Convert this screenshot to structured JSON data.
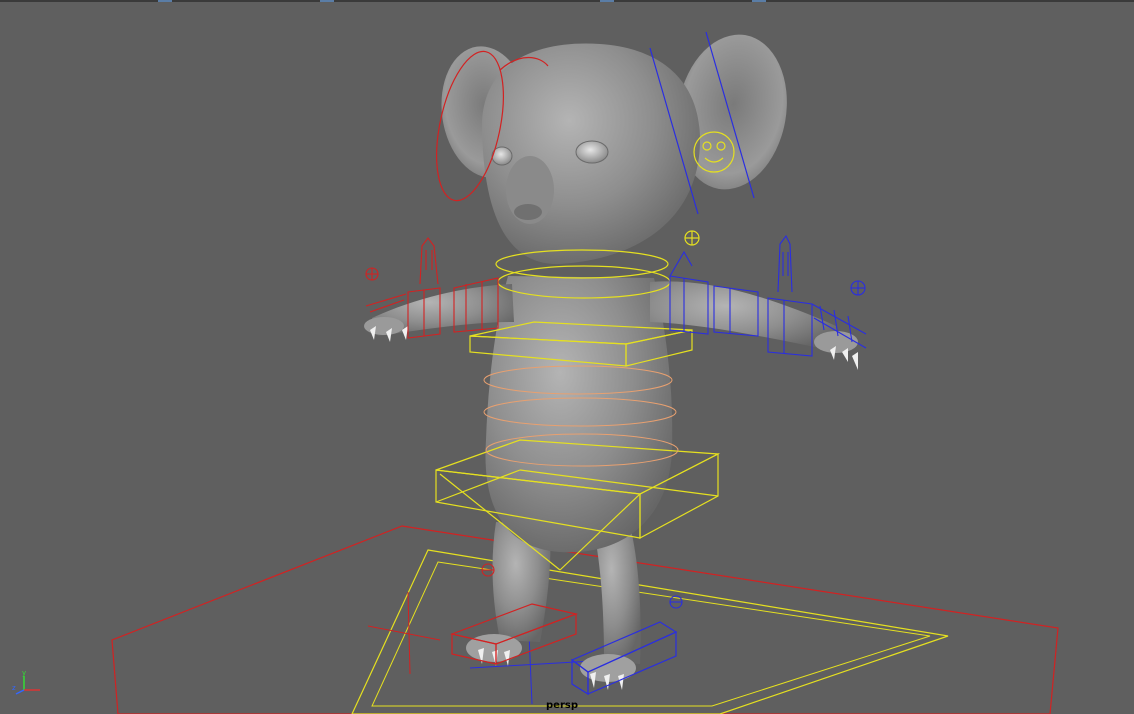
{
  "viewport": {
    "camera_label": "persp",
    "background_color": "#5f5f5f",
    "axis_labels": {
      "y": "y",
      "z": "z"
    }
  },
  "colors": {
    "left_controls": "#d22222",
    "right_controls": "#2a2ee0",
    "center_controls": "#e5e020",
    "spine_controls": "#e8a070",
    "model": "#8c8c8c"
  },
  "scene_objects": {
    "character": "koala-model",
    "controls": [
      "root-ctrl",
      "cog-ctrl",
      "hip-ctrl",
      "spine-ctrls",
      "chest-ctrl",
      "neck-ctrl",
      "head-ctrl",
      "ear-l-ctrl",
      "ear-r-ctrl",
      "face-ctrl",
      "arm-l-fk-ctrls",
      "arm-r-fk-ctrls",
      "hand-l-ctrl",
      "hand-r-ctrl",
      "foot-l-ctrl",
      "foot-r-ctrl",
      "pole-l-ctrl",
      "pole-r-ctrl"
    ]
  }
}
